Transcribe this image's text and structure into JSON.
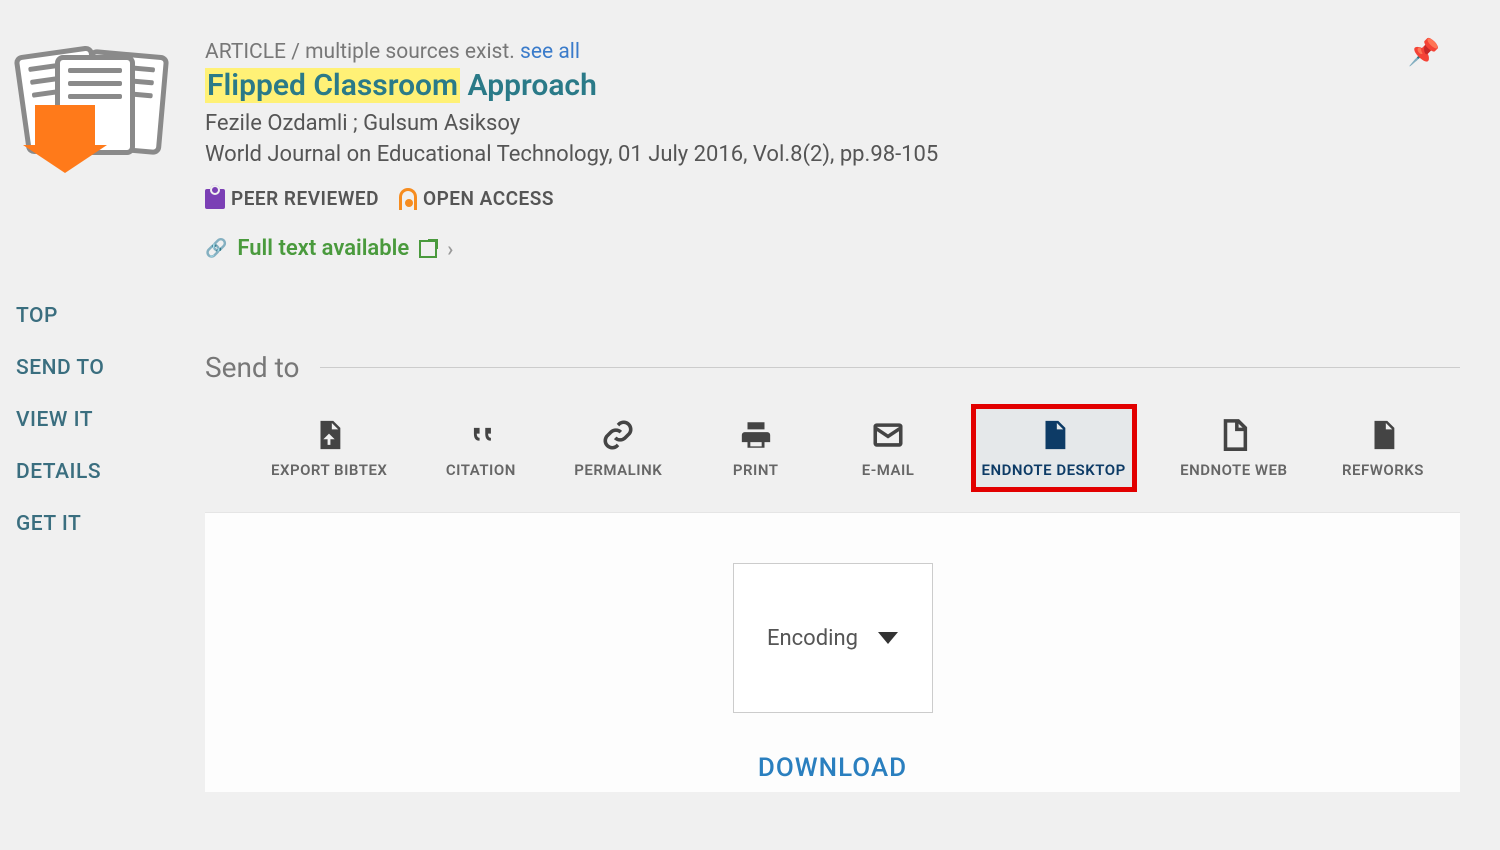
{
  "record": {
    "type_label": "ARTICLE",
    "multi_sources_label": "multiple sources exist.",
    "see_all_label": "see all",
    "title_highlighted": "Flipped Classroom",
    "title_rest": " Approach",
    "authors": "Fezile Ozdamli ; Gulsum Asiksoy",
    "source": "World Journal on Educational Technology, 01 July 2016, Vol.8(2), pp.98-105",
    "peer_reviewed_label": "PEER REVIEWED",
    "open_access_label": "OPEN ACCESS",
    "full_text_label": "Full text available"
  },
  "sidebar": {
    "items": [
      {
        "label": "TOP"
      },
      {
        "label": "SEND TO"
      },
      {
        "label": "VIEW IT"
      },
      {
        "label": "DETAILS"
      },
      {
        "label": "GET IT"
      }
    ]
  },
  "send_to": {
    "heading": "Send to",
    "options": [
      {
        "label": "EXPORT BIBTEX",
        "selected": false
      },
      {
        "label": "CITATION",
        "selected": false
      },
      {
        "label": "PERMALINK",
        "selected": false
      },
      {
        "label": "PRINT",
        "selected": false
      },
      {
        "label": "E-MAIL",
        "selected": false
      },
      {
        "label": "ENDNOTE DESKTOP",
        "selected": true
      },
      {
        "label": "ENDNOTE WEB",
        "selected": false
      },
      {
        "label": "REFWORKS",
        "selected": false
      }
    ],
    "encoding_label": "Encoding",
    "download_label": "DOWNLOAD"
  }
}
